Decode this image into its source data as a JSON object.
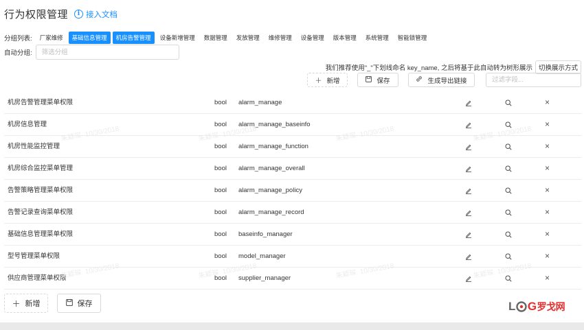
{
  "header": {
    "title": "行为权限管理",
    "doc_link": "接入文档"
  },
  "groups": {
    "label": "分组列表:",
    "tags": [
      {
        "label": "厂家维修",
        "active": false
      },
      {
        "label": "基础信息管理",
        "active": true
      },
      {
        "label": "机房告警管理",
        "active": true
      },
      {
        "label": "设备新增管理",
        "active": false
      },
      {
        "label": "数据管理",
        "active": false
      },
      {
        "label": "发放管理",
        "active": false
      },
      {
        "label": "维修管理",
        "active": false
      },
      {
        "label": "设备管理",
        "active": false
      },
      {
        "label": "版本管理",
        "active": false
      },
      {
        "label": "系统管理",
        "active": false
      },
      {
        "label": "智能锁管理",
        "active": false
      }
    ]
  },
  "auto_group": {
    "label": "自动分组:",
    "placeholder": "筛选分组"
  },
  "hint": {
    "text": "我们推荐使用\"_\"下划线命名 key_name, 之后将基于此自动转为树形展示",
    "switch_label": "切换展示方式"
  },
  "toolbar": {
    "add_label": "新增",
    "save_label": "保存",
    "export_label": "生成导出链接",
    "filter_placeholder": "过滤字段..."
  },
  "rows": [
    {
      "name": "机房告警管理菜单权限",
      "type": "bool",
      "key": "alarm_manage"
    },
    {
      "name": "机房信息管理",
      "type": "bool",
      "key": "alarm_manage_baseinfo"
    },
    {
      "name": "机房性能监控管理",
      "type": "bool",
      "key": "alarm_manage_function"
    },
    {
      "name": "机房综合监控菜单管理",
      "type": "bool",
      "key": "alarm_manage_overall"
    },
    {
      "name": "告警策略管理菜单权限",
      "type": "bool",
      "key": "alarm_manage_policy"
    },
    {
      "name": "告警记录查询菜单权限",
      "type": "bool",
      "key": "alarm_manage_record"
    },
    {
      "name": "基础信息管理菜单权限",
      "type": "bool",
      "key": "baseinfo_manager"
    },
    {
      "name": "型号管理菜单权限",
      "type": "bool",
      "key": "model_manager"
    },
    {
      "name": "供应商管理菜单权限",
      "type": "bool",
      "key": "supplier_manager"
    }
  ],
  "bottom": {
    "add_label": "新增",
    "save_label": "保存"
  },
  "watermark": {
    "name": "朱颖琛",
    "date": "10/30/2018"
  },
  "logo": {
    "lo": "L",
    "o": "O",
    "g": "G",
    "cn": "罗戈网"
  },
  "colors": {
    "accent": "#1890ff",
    "logo_red": "#e52e2e"
  }
}
